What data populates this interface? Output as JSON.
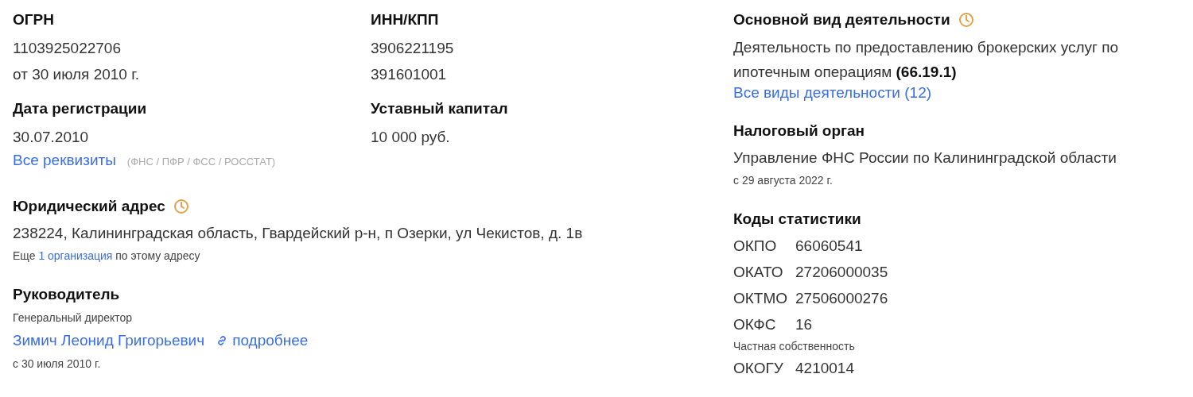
{
  "summary_fields": [
    {
      "title": "ОГРН",
      "values": [
        "1103925022706",
        "от 30 июля 2010 г."
      ]
    },
    {
      "title": "ИНН/КПП",
      "values": [
        "3906221195",
        "391601001"
      ]
    },
    {
      "title": "Дата регистрации",
      "values": [
        "30.07.2010"
      ]
    },
    {
      "title": "Уставный капитал",
      "values": [
        "10 000 руб."
      ]
    }
  ],
  "requisites_link": {
    "label": "Все реквизиты",
    "note": "(ФНС / ПФР / ФСС / РОССТАТ)"
  },
  "legal_address": {
    "title": "Юридический адрес",
    "history": true,
    "value": "238224, Калининградская область, Гвардейский р-н, п Озерки, ул Чекистов, д. 1в",
    "more_prefix": "Еще",
    "more_link": "1 организация",
    "more_suffix": "по этому адресу"
  },
  "manager": {
    "title": "Руководитель",
    "position": "Генеральный директор",
    "name": "Зимич Леонид Григорьевич",
    "details_link": "подробнее",
    "since": "с 30 июля 2010 г."
  },
  "main_activity": {
    "title": "Основной вид деятельности",
    "history": true,
    "text": "Деятельность по предоставлению брокерских услуг по ипотечным операциям **(66.19.1)**",
    "link": "Все виды деятельности (12)"
  },
  "tax_authority": {
    "title": "Налоговый орган",
    "value": "Управление ФНС России по Калининградской области",
    "since": "с 29 августа 2022 г."
  },
  "statistics_codes": {
    "title": "Коды статистики",
    "rows": [
      {
        "code": "ОКПО",
        "value": "66060541"
      },
      {
        "code": "ОКАТО",
        "value": "27206000035"
      },
      {
        "code": "ОКТМО",
        "value": "27506000276"
      },
      {
        "code": "ОКФС",
        "value": "16",
        "note": "Частная собственность"
      },
      {
        "code": "ОКОГУ",
        "value": "4210014"
      }
    ]
  }
}
